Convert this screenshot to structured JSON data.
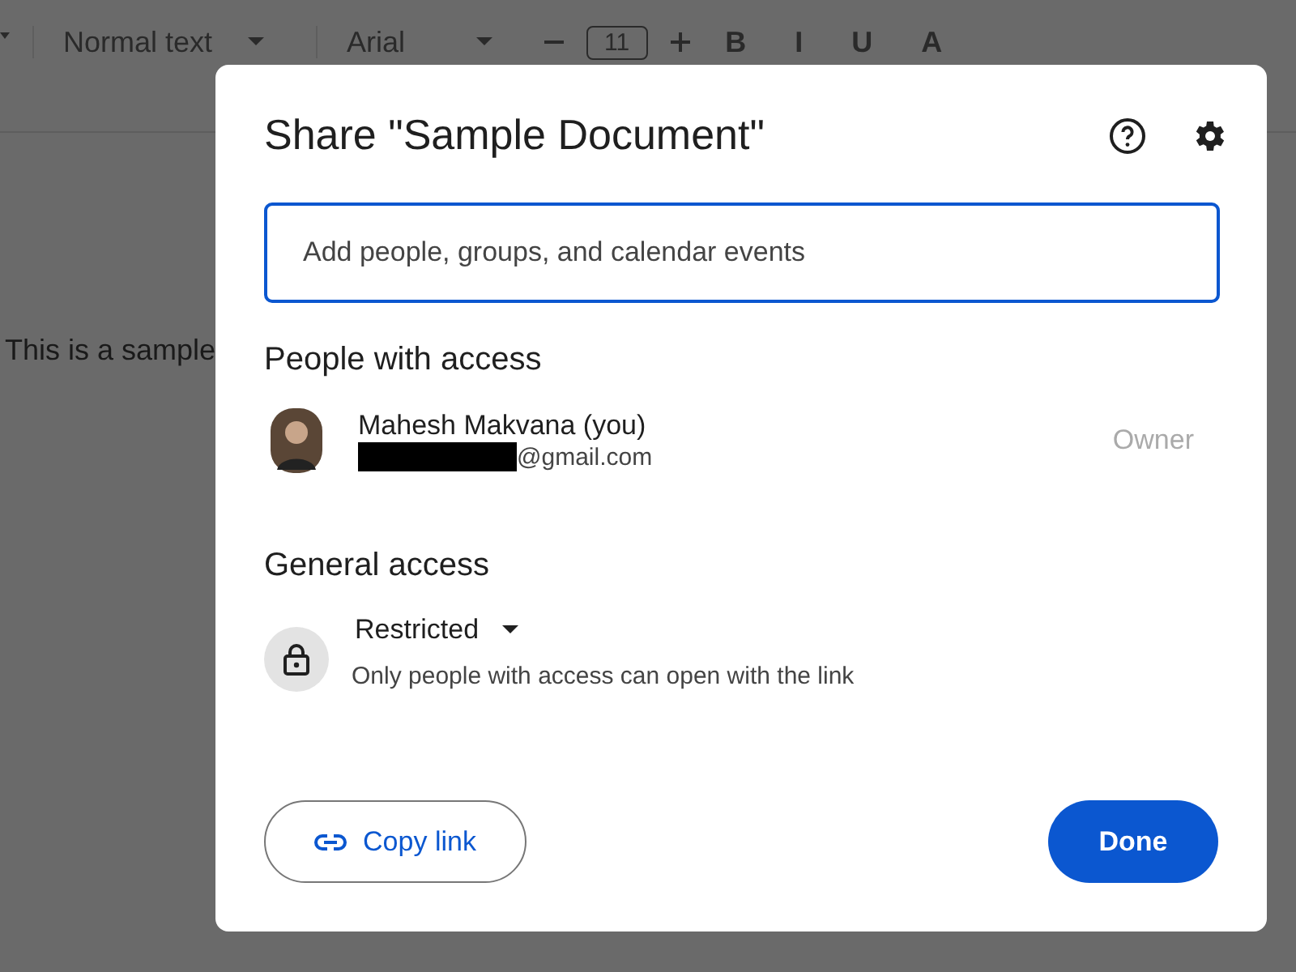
{
  "background": {
    "toolbar": {
      "style_select": "Normal text",
      "font_select": "Arial",
      "font_size": "11",
      "format_buttons": [
        "B",
        "I",
        "U",
        "A"
      ]
    },
    "document_text": "This is a sample"
  },
  "dialog": {
    "title": "Share \"Sample Document\"",
    "search": {
      "placeholder": "Add people, groups, and calendar events"
    },
    "people_heading": "People with access",
    "people": [
      {
        "name": "Mahesh Makvana (you)",
        "email": "@gmail.com",
        "email_redacted": true,
        "role": "Owner"
      }
    ],
    "general_heading": "General access",
    "general_access": {
      "level": "Restricted",
      "description": "Only people with access can open with the link"
    },
    "buttons": {
      "copy_link": "Copy link",
      "done": "Done"
    }
  }
}
